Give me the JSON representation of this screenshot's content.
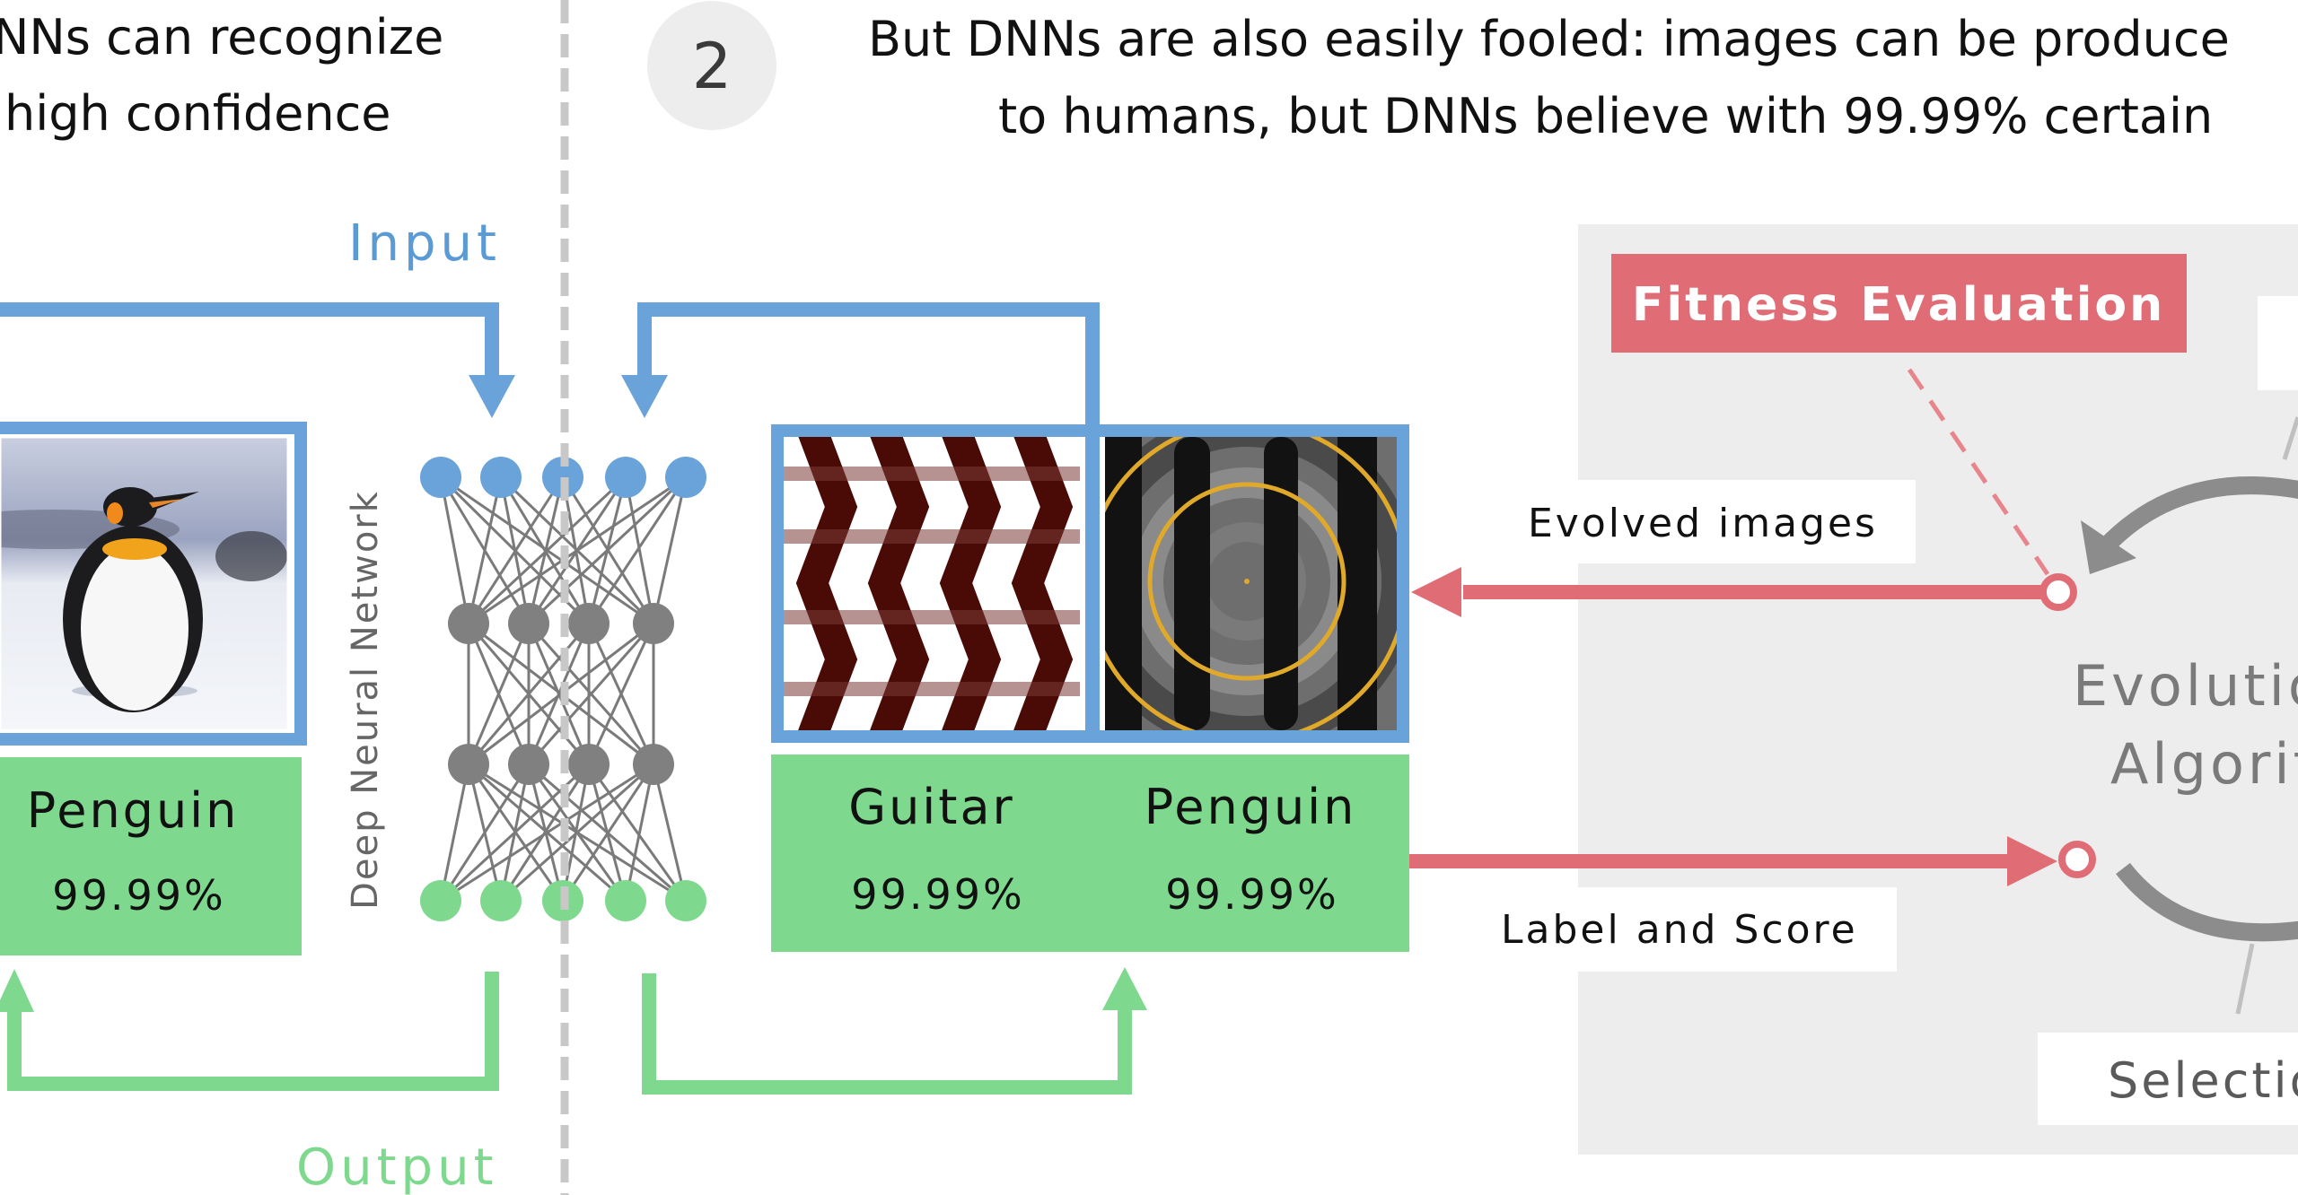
{
  "section1": {
    "caption_lines": [
      "NNs can recognize",
      "high confidence"
    ],
    "input_label": "Input",
    "output_label": "Output",
    "image": {
      "subject": "penguin-photo"
    },
    "prediction": {
      "label": "Penguin",
      "score": "99.99%"
    }
  },
  "network": {
    "label": "Deep Neural Network",
    "layers": [
      5,
      4,
      4,
      5
    ],
    "input_color": "#6aa3da",
    "hidden_color": "#808080",
    "output_color": "#7ed98e"
  },
  "section2": {
    "step_number": "2",
    "caption_lines": [
      "But DNNs are also easily fooled: images can be produce",
      "to humans, but DNNs believe with 99.99% certain"
    ],
    "images": [
      {
        "subject": "wavy-stripes-pattern",
        "label": "Guitar",
        "score": "99.99%"
      },
      {
        "subject": "concentric-rings-pattern",
        "label": "Penguin",
        "score": "99.99%"
      }
    ]
  },
  "evolution_panel": {
    "fitness_label": "Fitness Evaluation",
    "evolved_images_label": "Evolved images",
    "label_and_score_label": "Label and Score",
    "algorithm_lines": [
      "Evolutio",
      "Algorit"
    ],
    "selection_label": "Selectio"
  },
  "colors": {
    "blue": "#6aa3da",
    "green": "#7ed98e",
    "red": "#e06c75",
    "panel_gray": "#ededed",
    "divider_gray": "#c8c8c8"
  }
}
